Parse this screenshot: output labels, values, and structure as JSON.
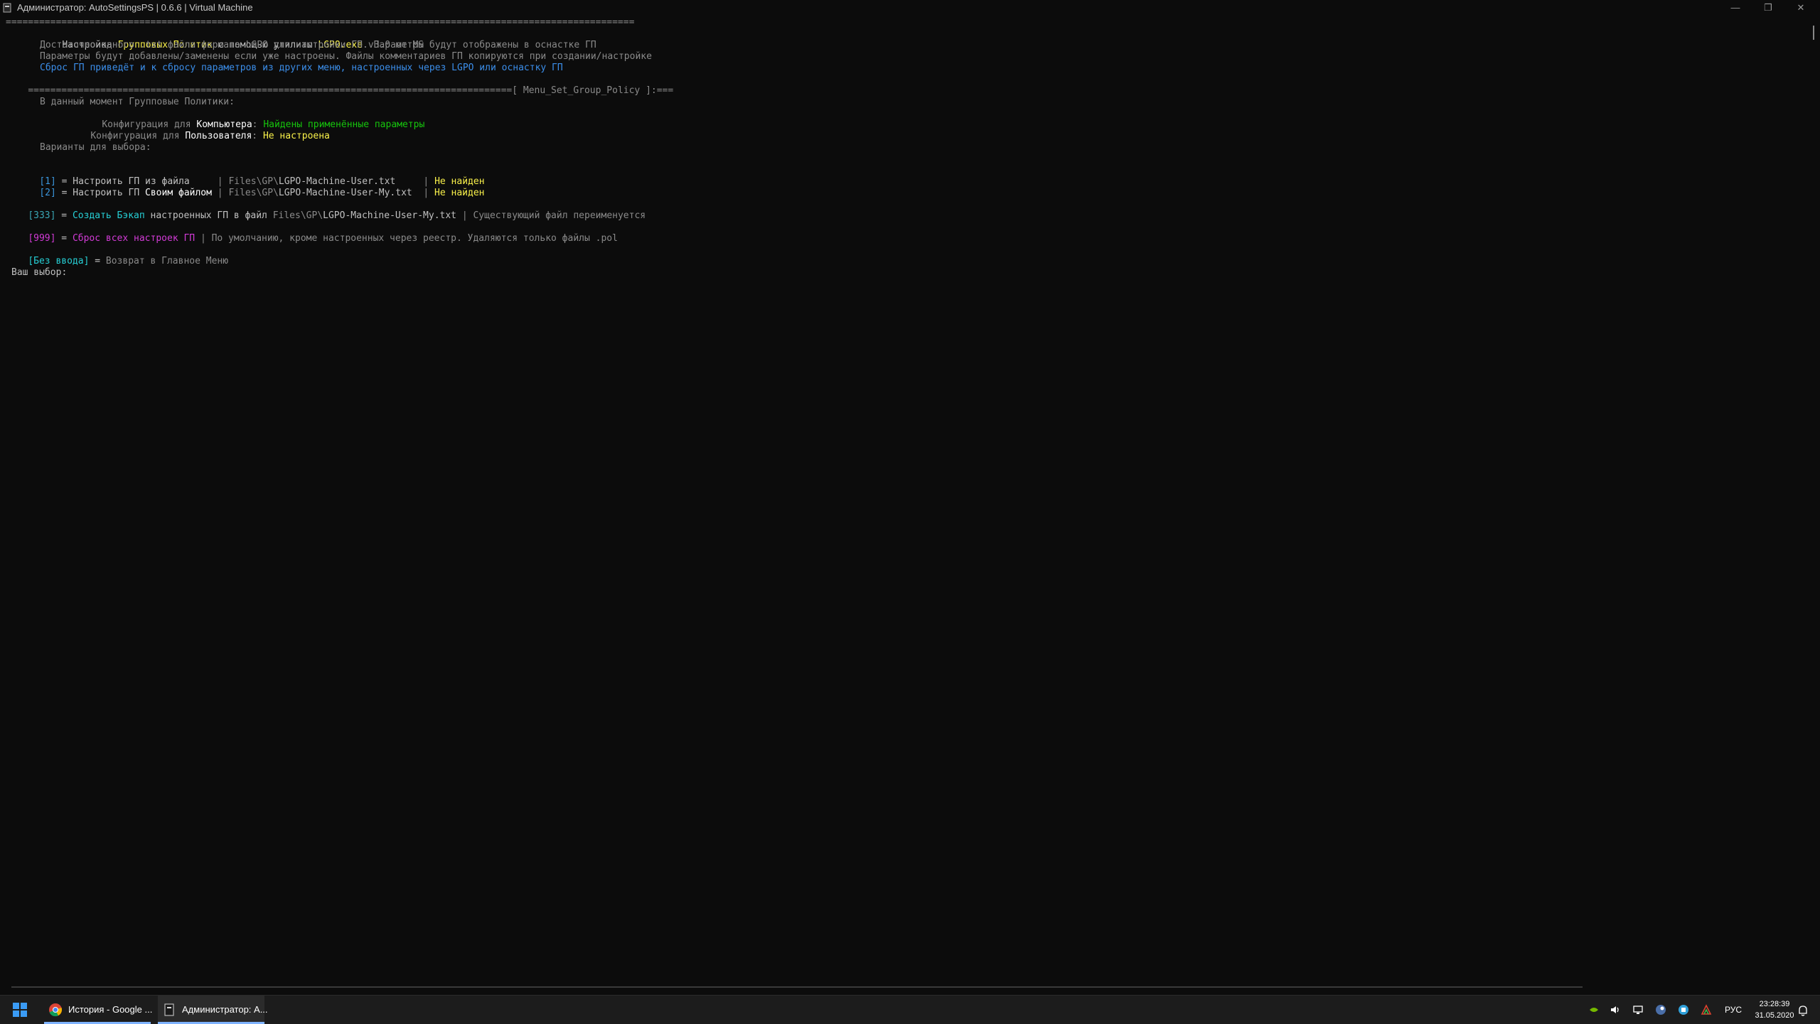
{
  "window": {
    "title": "Администратор: AutoSettingsPS | 0.6.6 | Virtual Machine",
    "minimize_glyph": "—",
    "restore_glyph": "❐",
    "close_glyph": "✕"
  },
  "console": {
    "separator_top": "=================================================================================================================",
    "header": {
      "l1": {
        "a": "Настройка ",
        "b": "Групповых Политик",
        "c": " с помощью утилиты ",
        "d": "LGPO.exe",
        "e": " v3.0 от MS"
      },
      "l2": "Достаточно одного .txt файла формата LGPO для настройки ГП. Параметры будут отображены в оснастке ГП",
      "l3": "Параметры будут добавлены/заменены если уже настроены. Файлы комментариев ГП копируются при создании/настройке",
      "l4": "Сброс ГП приведёт и к сбросу параметров из других меню, настроенных через LGPO или оснастку ГП"
    },
    "separator_bottom": {
      "bar": "=======================================================================================",
      "tag": "[ Menu_Set_Group_Policy ]",
      "tail": ":==="
    },
    "status": {
      "title": "В данный момент Групповые Политики:",
      "computer": {
        "prefix": "Конфигурация для ",
        "target": "Компьютера",
        "colon": ": ",
        "value": "Найдены применённые параметры"
      },
      "user": {
        "prefix": "Конфигурация для ",
        "target": "Пользователя",
        "colon": ": ",
        "value": "Не настроена"
      }
    },
    "options_title": "Варианты для выбора:",
    "options": [
      {
        "key": "[1]",
        "eq": " = ",
        "action": "Настроить ГП из файла",
        "action_extra": "",
        "pad": "     ",
        "sep": "| ",
        "path": "Files\\GP\\",
        "file": "LGPO-Machine-User.txt",
        "pad2": "     ",
        "sep2": "| ",
        "status": "Не найден"
      },
      {
        "key": "[2]",
        "eq": " = ",
        "action": "Настроить ГП ",
        "action_extra": "Своим файлом",
        "pad": " ",
        "sep": "| ",
        "path": "Files\\GP\\",
        "file": "LGPO-Machine-User-My.txt",
        "pad2": "  ",
        "sep2": "| ",
        "status": "Не найден"
      }
    ],
    "backup": {
      "key": "[333]",
      "eq": " = ",
      "action": "Создать Бэкап",
      "mid": " настроенных ГП в файл ",
      "path": "Files\\GP\\",
      "file": "LGPO-Machine-User-My.txt",
      "note": " | Существующий файл переименуется"
    },
    "reset": {
      "key": "[999]",
      "eq": " = ",
      "action": "Сброс всех настроек ГП",
      "note": " | По умолчанию, кроме настроенных через реестр. Удаляются только файлы .pol"
    },
    "noinput": {
      "key": "[Без ввода]",
      "eq": " = ",
      "action": "Возврат в Главное Меню"
    },
    "prompt": "Ваш выбор:"
  },
  "taskbar": {
    "items": [
      {
        "label": "История - Google ...",
        "icon": "chrome-icon"
      },
      {
        "label": "Администратор: A...",
        "icon": "terminal-icon"
      }
    ],
    "tray_icons": [
      "nvidia-icon",
      "volume-icon",
      "network-icon",
      "steam-icon",
      "app-icon",
      "antivirus-icon"
    ],
    "language": "РУС",
    "time": "23:28:39",
    "date": "31.05.2020"
  },
  "colors": {
    "console_bg": "#0c0c0c",
    "taskbar_bg": "#1c1c1c",
    "accent": "#7fb3ff"
  }
}
